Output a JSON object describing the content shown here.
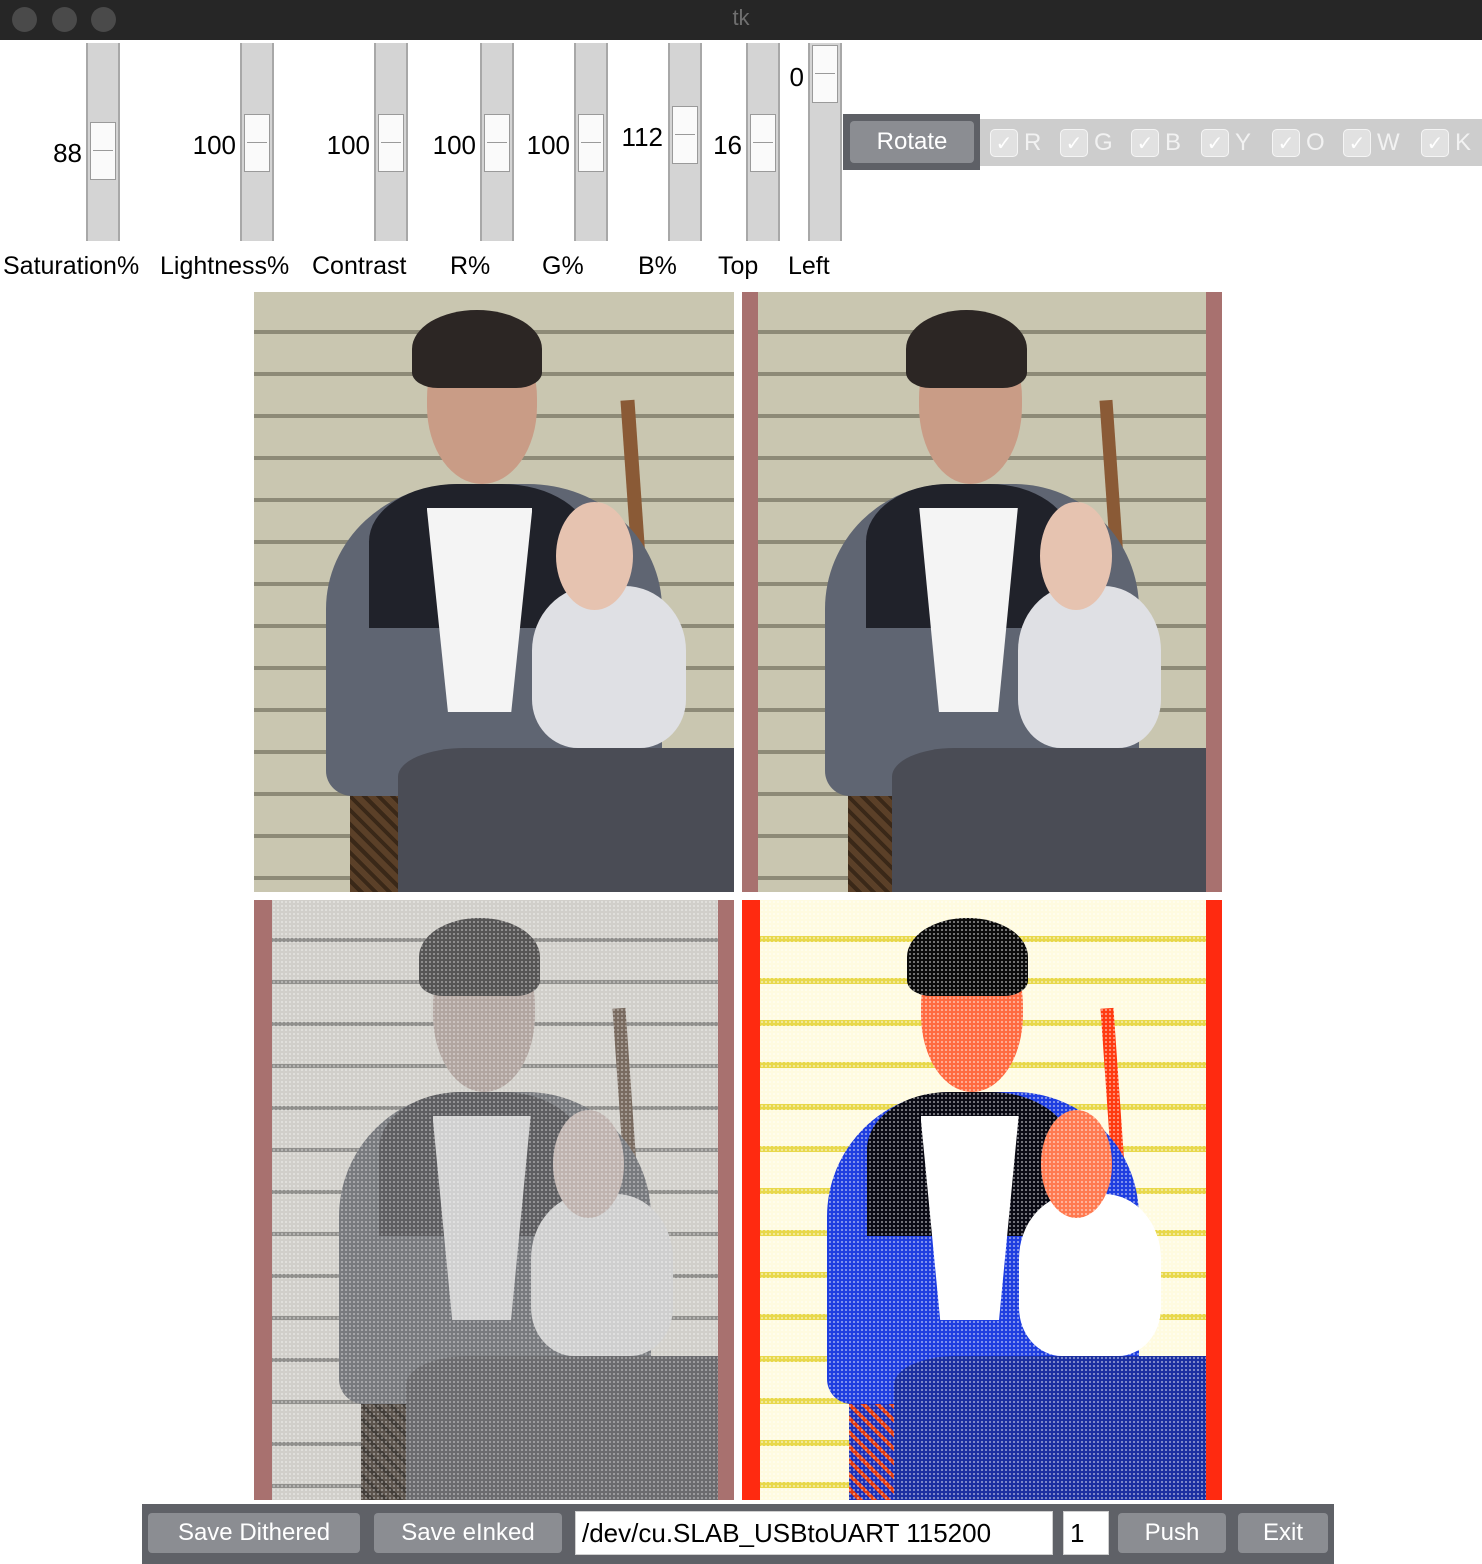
{
  "window": {
    "title": "tk"
  },
  "sliders": [
    {
      "name": "saturation",
      "label": "Saturation%",
      "value": "88"
    },
    {
      "name": "lightness",
      "label": "Lightness%",
      "value": "100"
    },
    {
      "name": "contrast",
      "label": "Contrast",
      "value": "100"
    },
    {
      "name": "r",
      "label": "R%",
      "value": "100"
    },
    {
      "name": "g",
      "label": "G%",
      "value": "100"
    },
    {
      "name": "b",
      "label": "B%",
      "value": "112"
    },
    {
      "name": "top",
      "label": "Top",
      "value": "16"
    },
    {
      "name": "left",
      "label": "Left",
      "value": "0"
    }
  ],
  "rotate_label": "Rotate",
  "color_checks": [
    {
      "label": "R",
      "checked": true
    },
    {
      "label": "G",
      "checked": true
    },
    {
      "label": "B",
      "checked": true
    },
    {
      "label": "Y",
      "checked": true
    },
    {
      "label": "O",
      "checked": true
    },
    {
      "label": "W",
      "checked": true
    },
    {
      "label": "K",
      "checked": true
    }
  ],
  "check_glyph": "✓",
  "images": [
    {
      "name": "original-image",
      "border_color": "#ffffff"
    },
    {
      "name": "adjusted-image",
      "border_color": "#a8716f"
    },
    {
      "name": "dithered-image",
      "border_color": "#a8716f"
    },
    {
      "name": "einked-image",
      "border_color": "#ff2a10"
    }
  ],
  "toolbar": {
    "save_dithered": "Save Dithered",
    "save_einked": "Save eInked",
    "port_value": "/dev/cu.SLAB_USBtoUART 115200",
    "count_value": "1",
    "push": "Push",
    "exit": "Exit"
  },
  "colors": {
    "titlebar": "#262626",
    "button": "#8b8d92",
    "toolbar": "#5f6167",
    "slider_track": "#d4d4d4"
  }
}
